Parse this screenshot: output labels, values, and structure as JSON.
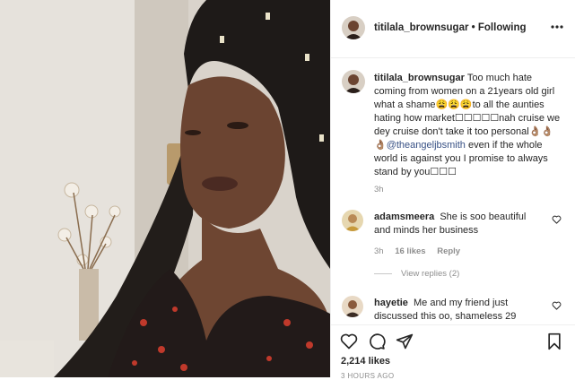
{
  "post": {
    "username": "titilala_brownsugar",
    "separator": "•",
    "follow_status": "Following",
    "more_icon": "more-horizontal-icon"
  },
  "caption": {
    "username": "titilala_brownsugar",
    "text_before_mention": "Too much hate coming from women on a 21years old girl what a shame😩😩😩to all the aunties hating how market☐☐☐☐☐nah cruise we dey cruise don't take it too personal👌🏽👌🏽👌🏽",
    "mention": "@theangeljbsmith",
    "text_after_mention": " even if the whole world is against you I promise to always stand by you☐☐☐",
    "time": "3h"
  },
  "comments": [
    {
      "username": "adamsmeera",
      "text": "She is soo beautiful and minds her business",
      "time": "3h",
      "likes": "16 likes",
      "reply": "Reply",
      "view_replies": "View replies (2)"
    },
    {
      "username": "hayetie",
      "text": "Me and my friend just discussed this oo, shameless 29"
    }
  ],
  "actions": {
    "like_icon": "heart-icon",
    "comment_icon": "comment-icon",
    "share_icon": "send-icon",
    "save_icon": "bookmark-icon",
    "likes_count": "2,214 likes",
    "posted_ago": "3 HOURS AGO"
  },
  "colors": {
    "text": "#262626",
    "secondary": "#8e8e8e",
    "link": "#385185",
    "divider": "#efefef"
  }
}
